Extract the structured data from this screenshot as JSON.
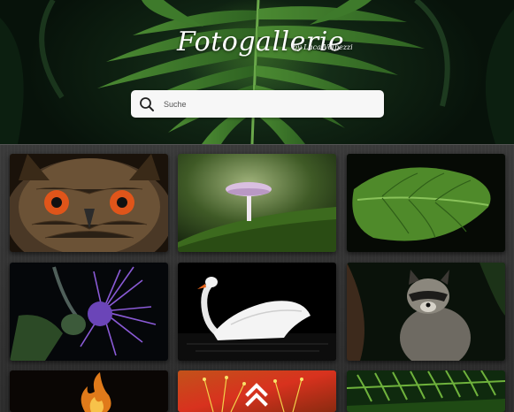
{
  "header": {
    "title": "Fotogallerie",
    "byline": "by Luca Volpezzi"
  },
  "search": {
    "placeholder": "Suche",
    "value": ""
  },
  "gallery": {
    "photos": [
      {
        "subject": "owl"
      },
      {
        "subject": "mushroom"
      },
      {
        "subject": "leaf"
      },
      {
        "subject": "thistle"
      },
      {
        "subject": "swan"
      },
      {
        "subject": "raccoon"
      },
      {
        "subject": "fire"
      },
      {
        "subject": "flower"
      },
      {
        "subject": "fern"
      }
    ]
  },
  "icons": {
    "search": "search-icon",
    "scroll_top": "double-chevron-up-icon"
  },
  "colors": {
    "hero_dark": "#07120a",
    "fern_green": "#5a9a3a",
    "gallery_bg": "#333333",
    "search_bg": "#f7f7f7"
  }
}
